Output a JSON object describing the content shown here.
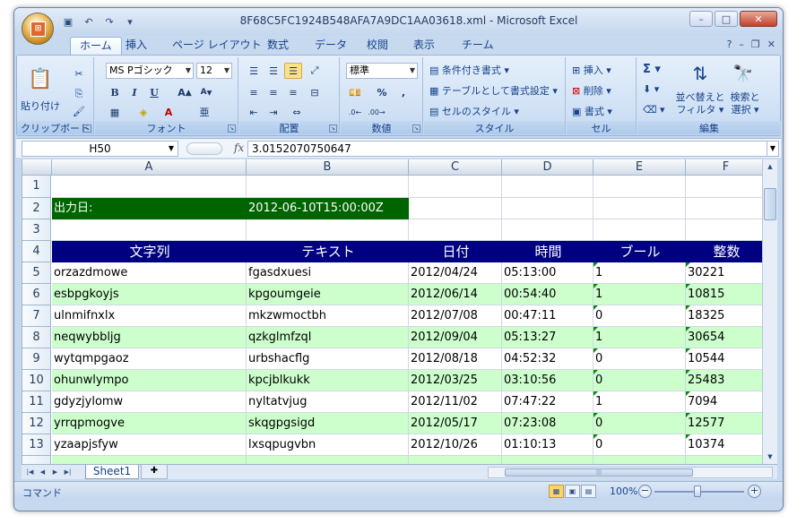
{
  "window": {
    "title": "8F68C5FC1924B548AFA7A9DC1AA03618.xml - Microsoft Excel",
    "office_logo": "Office",
    "qat": [
      "save-icon",
      "undo-icon",
      "redo-icon",
      "customize-icon"
    ]
  },
  "tabs": [
    {
      "label": "ホーム",
      "active": true
    },
    {
      "label": "挿入"
    },
    {
      "label": "ページ レイアウト"
    },
    {
      "label": "数式"
    },
    {
      "label": "データ"
    },
    {
      "label": "校閲"
    },
    {
      "label": "表示"
    },
    {
      "label": "チーム"
    }
  ],
  "ribbon": {
    "clipboard": {
      "label": "クリップボード",
      "paste": "貼り付け"
    },
    "font": {
      "label": "フォント",
      "name": "MS Pゴシック",
      "size": "12",
      "bold": "B",
      "italic": "I",
      "underline": "U"
    },
    "alignment": {
      "label": "配置"
    },
    "number": {
      "label": "数値",
      "format": "標準",
      "percent": "%",
      "comma": ","
    },
    "styles": {
      "label": "スタイル",
      "conditional": "条件付き書式",
      "table": "テーブルとして書式設定",
      "cell": "セルのスタイル"
    },
    "cells": {
      "label": "セル",
      "insert": "挿入",
      "delete": "削除",
      "format": "書式"
    },
    "editing": {
      "label": "編集",
      "sort": "並べ替えと",
      "sort2": "フィルタ",
      "find": "検索と",
      "find2": "選択"
    }
  },
  "formula_bar": {
    "name_box": "H50",
    "fx": "fx",
    "value": "3.0152070750647"
  },
  "columns": [
    "A",
    "B",
    "C",
    "D",
    "E",
    "F"
  ],
  "rows": [
    {
      "num": "1",
      "cells": [
        "",
        "",
        "",
        "",
        "",
        ""
      ]
    },
    {
      "num": "2",
      "cells": [
        "出力日:",
        "2012-06-10T15:00:00Z",
        "",
        "",
        "",
        ""
      ]
    },
    {
      "num": "3",
      "cells": [
        "",
        "",
        "",
        "",
        "",
        ""
      ]
    },
    {
      "num": "4",
      "cells": [
        "文字列",
        "テキスト",
        "日付",
        "時間",
        "ブール",
        "整数"
      ]
    },
    {
      "num": "5",
      "cells": [
        "orzazdmowe",
        "fgasdxuesi",
        "2012/04/24",
        "05:13:00",
        "1",
        "30221"
      ]
    },
    {
      "num": "6",
      "cells": [
        "esbpgkoyjs",
        "kpgoumgeie",
        "2012/06/14",
        "00:54:40",
        "1",
        "10815"
      ]
    },
    {
      "num": "7",
      "cells": [
        "ulnmifnxlx",
        "mkzwmoctbh",
        "2012/07/08",
        "00:47:11",
        "0",
        "18325"
      ]
    },
    {
      "num": "8",
      "cells": [
        "neqwybbljg",
        "qzkglmfzql",
        "2012/09/04",
        "05:13:27",
        "1",
        "30654"
      ]
    },
    {
      "num": "9",
      "cells": [
        "wytqmpgaoz",
        "urbshacflg",
        "2012/08/18",
        "04:52:32",
        "0",
        "10544"
      ]
    },
    {
      "num": "10",
      "cells": [
        "ohunwlympo",
        "kpcjblkukk",
        "2012/03/25",
        "03:10:56",
        "0",
        "25483"
      ]
    },
    {
      "num": "11",
      "cells": [
        "gdyzjylomw",
        "nyltatvjug",
        "2012/11/02",
        "07:47:22",
        "1",
        "7094"
      ]
    },
    {
      "num": "12",
      "cells": [
        "yrrqpmogve",
        "skqgpgsigd",
        "2012/05/17",
        "07:23:08",
        "0",
        "12577"
      ]
    },
    {
      "num": "13",
      "cells": [
        "yzaapjsfyw",
        "lxsqpugvbn",
        "2012/10/26",
        "01:10:13",
        "0",
        "10374"
      ]
    }
  ],
  "sheet_tab": "Sheet1",
  "status": {
    "mode": "コマンド",
    "zoom": "100%"
  },
  "colors": {
    "header_bg": "#000080",
    "band_bg": "#ccffcc",
    "date_bg": "#006400"
  }
}
